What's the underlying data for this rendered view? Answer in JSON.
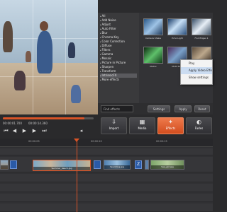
{
  "effects_list": {
    "items": [
      "All",
      "Add Noise",
      "Adjust",
      "Auto Filter",
      "Blur",
      "Chroma Key",
      "Color Correction",
      "Diffuse",
      "Filters",
      "Gamma",
      "Mosaic",
      "Picture in Picture",
      "Sharpen",
      "Transform",
      "IntrinsicFX",
      "More effects"
    ],
    "selected_index": 14
  },
  "thumbs": {
    "items": [
      "Camera Shake",
      "Echo Light",
      "Find Edges 1",
      "Matrix",
      "Multi Slow",
      ""
    ]
  },
  "context_menu": {
    "items": [
      "Play",
      "Apply Video Effe...",
      "Show settings"
    ],
    "highlighted_index": 1
  },
  "filter": {
    "placeholder": "Find effects",
    "settings_label": "Settings",
    "apply_label": "Apply",
    "reset_label": "Reset"
  },
  "playback": {
    "timecode_current": "00:00:01.700",
    "timecode_total": "00:00:14.360",
    "progress": 0.9
  },
  "tools": [
    {
      "label": "Import",
      "icon": "import-icon",
      "active": false
    },
    {
      "label": "Media",
      "icon": "film-icon",
      "active": false
    },
    {
      "label": "Effects",
      "icon": "fx-icon",
      "active": true
    },
    {
      "label": "Fades",
      "icon": "fade-icon",
      "active": false
    }
  ],
  "timeline": {
    "ruler_marks": [
      "00:00:05",
      "00:00:10",
      "00:00:15"
    ],
    "clips": [
      "",
      "Summer_beach.jpg",
      "Sparkling.jpg",
      "Sea_girl.jpg"
    ],
    "transitions": [
      "Z",
      "Z"
    ]
  },
  "colors": {
    "accent": "#d95427",
    "panel": "#3a3a3c",
    "transition": "#2a5aa6"
  }
}
